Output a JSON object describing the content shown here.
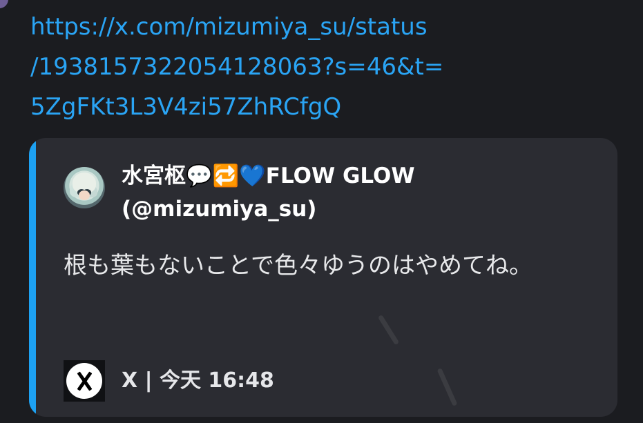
{
  "message": {
    "url_lines": [
      "https://x.com/mizumiya_su/status",
      "/1938157322054128063?s=46&t=",
      "5ZgFKt3L3V4zi57ZhRCfgQ"
    ]
  },
  "embed": {
    "accent_color": "#1da1f2",
    "author_name": "水宮枢💬🔁💙FLOW GLOW",
    "author_handle": "(@mizumiya_su)",
    "text": "根も葉もないことで色々ゆうのはやめてね。",
    "footer": {
      "source": "X | 今天 16:48",
      "icon": "x-logo-icon"
    }
  }
}
